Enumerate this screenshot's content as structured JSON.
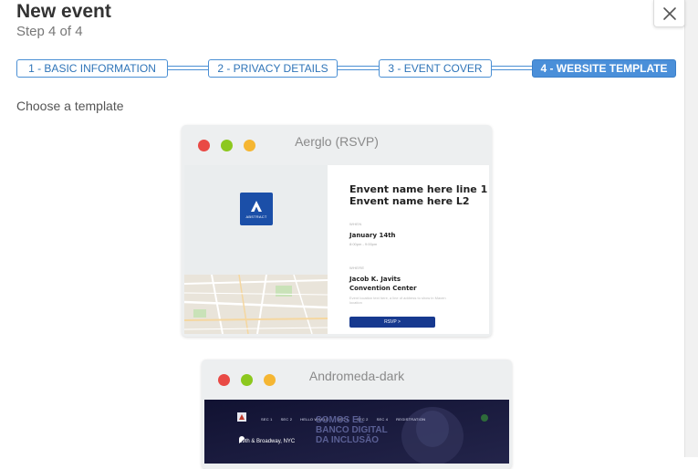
{
  "header": {
    "title": "New event",
    "subtitle": "Step 4 of 4"
  },
  "steps": [
    {
      "label": "1 - BASIC INFORMATION",
      "active": false
    },
    {
      "label": "2 - PRIVACY DETAILS",
      "active": false
    },
    {
      "label": "3 - EVENT COVER",
      "active": false
    },
    {
      "label": "4 - WEBSITE TEMPLATE",
      "active": true
    }
  ],
  "choose_label": "Choose a template",
  "templates": [
    {
      "name": "Aerglo (RSVP)",
      "preview": {
        "logo_text": "ABSTRACT",
        "event_title_1": "Envent name here line 1",
        "event_title_2": "Envent name here L2",
        "when_label": "WHEN",
        "date": "January 14th",
        "date_sub": "8:00pm - 9:00pm",
        "where_label": "WHERE",
        "venue_1": "Jacob K. Javits",
        "venue_2": "Convention Center",
        "venue_sub": "Event location text here, a line of address to show in Maven location",
        "rsvp_label": "RSVP >"
      }
    },
    {
      "name": "Andromeda-dark",
      "preview": {
        "nav": [
          "SEC 1",
          "SEC 2",
          "HELLO WORLD",
          "SEC 1",
          "SEC 2",
          "SEC 4",
          "REGISTRATION"
        ],
        "hero_1": "SOMOS EL",
        "hero_2": "BANCO DIGITAL",
        "hero_3": "DA INCLUSÃO",
        "address": "39th & Broadway, NYC"
      }
    }
  ],
  "colors": {
    "accent": "#4a8fd9",
    "step_border": "#4a8fd4",
    "dot_red": "#e94a45",
    "dot_green": "#8cc81e",
    "dot_yellow": "#f5b632",
    "rsvp": "#17398f",
    "andromeda_bg": "#1a1a3a"
  }
}
